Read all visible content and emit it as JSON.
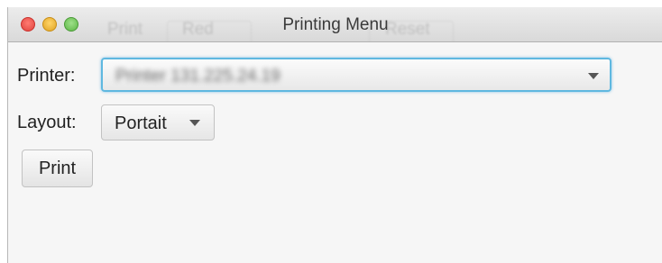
{
  "window": {
    "title": "Printing Menu",
    "background_ghost": {
      "print_label": "Print",
      "red_label": "Red",
      "reset_label": "Reset"
    }
  },
  "form": {
    "printer_label": "Printer:",
    "printer_value": "Printer 131.225.24.19",
    "layout_label": "Layout:",
    "layout_value": "Portait",
    "print_button_label": "Print"
  },
  "colors": {
    "focus_ring": "#5fb8e0",
    "close": "#e0443e",
    "minimize": "#e0a423",
    "zoom": "#5cb645"
  },
  "icons": {
    "close": "close-traffic-light",
    "minimize": "minimize-traffic-light",
    "zoom": "zoom-traffic-light",
    "dropdown": "chevron-down-icon"
  }
}
